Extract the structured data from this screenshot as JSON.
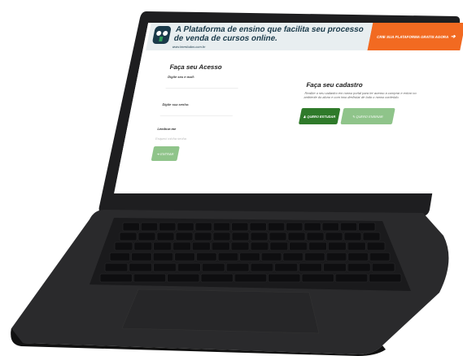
{
  "banner": {
    "headline": "A Plataforma de ensino que facilita seu processo de venda de cursos online.",
    "url": "www.imestudos.com.br",
    "cta_label": "CRIE SUA PLATAFORMA GRATIS AGORA",
    "cta_icon": "arrow-right-icon",
    "colors": {
      "background": "#e8eef0",
      "cta": "#f26a21",
      "text": "#1a3a4a"
    }
  },
  "login": {
    "title": "Faça seu Acesso",
    "email_label": "Digite seu e-mail:",
    "password_label": "Digite sua senha:",
    "remember_label": "Lembrar-me",
    "forgot_label": "Esqueci minha senha",
    "enter_label": "ENTRAR"
  },
  "register": {
    "title": "Faça seu cadastro",
    "text": "Realize o seu cadastro em nosso portal para ter acesso a comprar e entrar no ambiente do aluno e com isso desfrutar de todo o nosso conteúdo.",
    "study_label": "QUERO ESTUDAR",
    "teach_label": "QUERO ENSINAR",
    "colors": {
      "study": "#2f7a2a",
      "teach": "#8fc48a"
    }
  }
}
